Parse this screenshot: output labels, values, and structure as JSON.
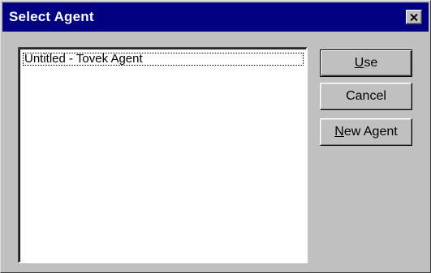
{
  "window": {
    "title": "Select Agent",
    "close_icon": "close-icon"
  },
  "agent_list": {
    "items": [
      {
        "label": "Untitled - Tovek Agent",
        "selected": true
      }
    ]
  },
  "buttons": {
    "use": {
      "mnemonic": "U",
      "rest": "se"
    },
    "cancel": {
      "label": "Cancel"
    },
    "new_agent": {
      "mnemonic": "N",
      "rest": "ew Agent"
    }
  }
}
